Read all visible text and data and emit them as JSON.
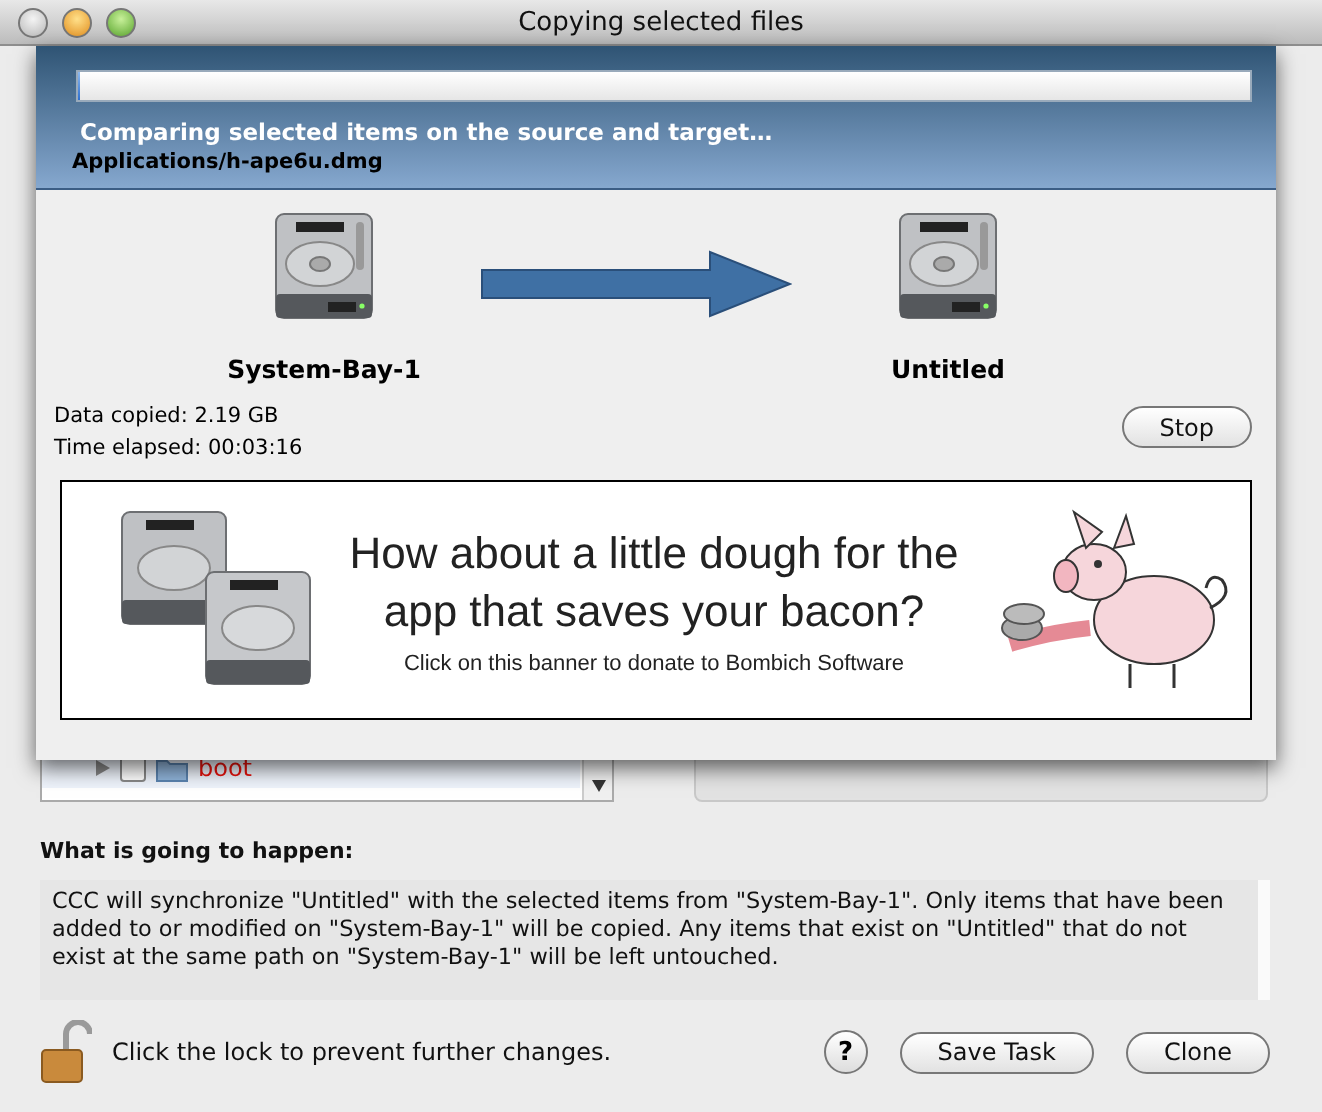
{
  "window": {
    "title": "Copying selected files"
  },
  "progress": {
    "level": 0,
    "status": "Comparing selected items on the source and target…",
    "current_file": "Applications/h-ape6u.dmg"
  },
  "source": {
    "name": "System-Bay-1"
  },
  "target": {
    "name": "Untitled"
  },
  "stats": [
    "Data copied: 2.19 GB",
    "Time elapsed: 00:03:16"
  ],
  "stop_button": "Stop",
  "banner": {
    "headline": "How about a little dough for the app that saves your bacon?",
    "subtitle": "Click on this banner to donate to Bombich Software"
  },
  "items": [
    {
      "name": "boot",
      "checked": false,
      "expanded": false
    }
  ],
  "description": {
    "heading": "What is going to happen:",
    "text": "CCC will synchronize \"Untitled\" with the selected items from \"System-Bay-1\". Only items that have been added to or modified on \"System-Bay-1\" will be copied. Any items that exist on \"Untitled\" that do not exist at the same path on \"System-Bay-1\" will be left untouched."
  },
  "lock": {
    "locked": false,
    "label": "Click the lock to prevent further changes."
  },
  "help_button": "?",
  "buttons": [
    {
      "label": "Save Task"
    },
    {
      "label": "Clone"
    }
  ]
}
